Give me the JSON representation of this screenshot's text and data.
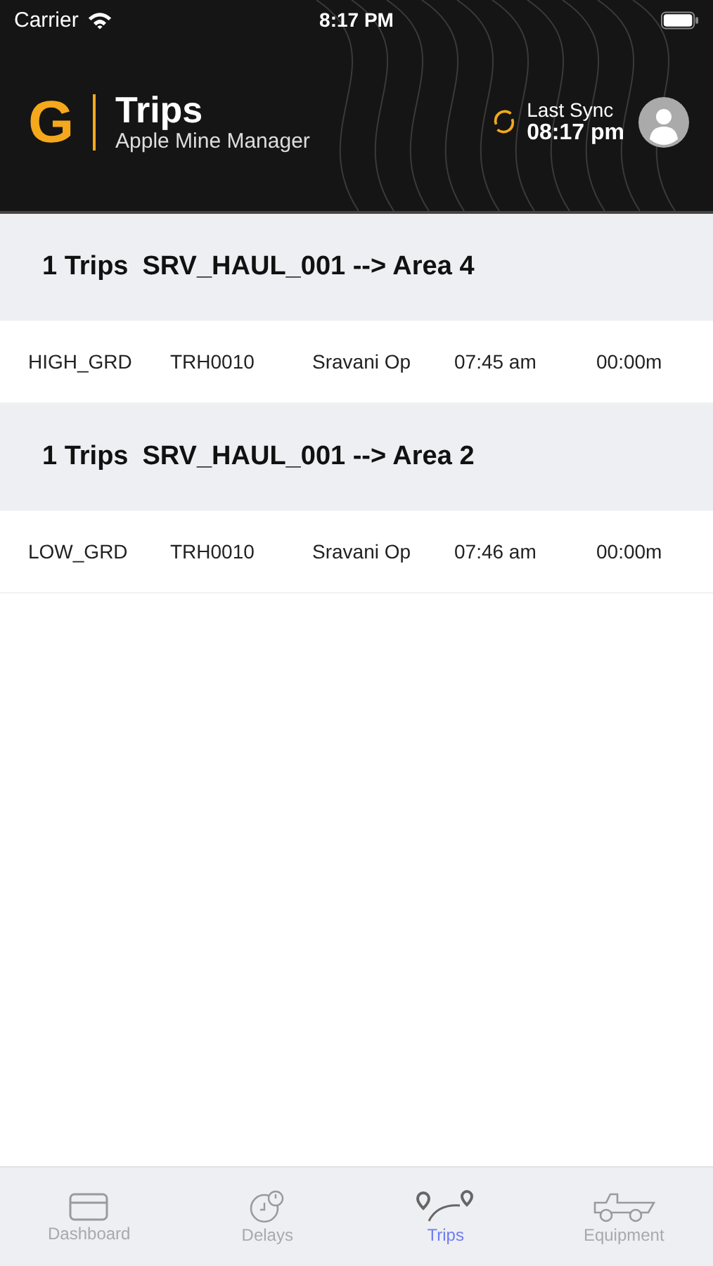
{
  "status_bar": {
    "carrier": "Carrier",
    "time": "8:17 PM"
  },
  "header": {
    "logo": "G",
    "title": "Trips",
    "subtitle": "Apple Mine Manager",
    "sync_label": "Last Sync",
    "sync_time": "08:17 pm"
  },
  "groups": [
    {
      "count": "1 Trips",
      "route": "SRV_HAUL_001 --> Area 4",
      "rows": [
        [
          "HIGH_GRD",
          "TRH0010",
          "Sravani Op",
          "07:45 am",
          "00:00m"
        ]
      ]
    },
    {
      "count": "1 Trips",
      "route": "SRV_HAUL_001 --> Area 2",
      "rows": [
        [
          "LOW_GRD",
          "TRH0010",
          "Sravani Op",
          "07:46 am",
          "00:00m"
        ]
      ]
    }
  ],
  "tab_bar": [
    {
      "kind": "dashboard",
      "label": "Dashboard",
      "selected": false
    },
    {
      "kind": "delays",
      "label": "Delays",
      "selected": false
    },
    {
      "kind": "trips",
      "label": "Trips",
      "selected": true
    },
    {
      "kind": "equipment",
      "label": "Equipment",
      "selected": false
    }
  ]
}
